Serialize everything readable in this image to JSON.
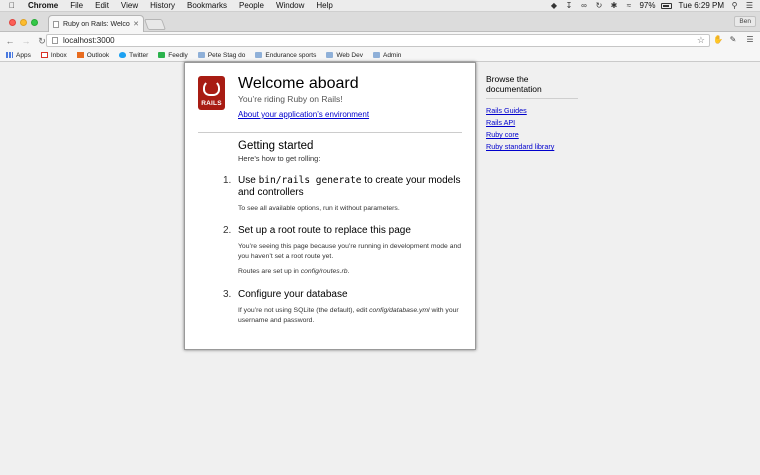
{
  "menubar": {
    "app_name": "Chrome",
    "menus": [
      "File",
      "Edit",
      "View",
      "History",
      "Bookmarks",
      "People",
      "Window",
      "Help"
    ],
    "battery": "97%",
    "clock": "Tue 6:29 PM"
  },
  "tab": {
    "title": "Ruby on Rails: Welcome aboard"
  },
  "profile_label": "Ben",
  "address_bar": {
    "url": "localhost:3000"
  },
  "bookmarks": [
    {
      "label": "Apps",
      "icon": "apps-grid-icon"
    },
    {
      "label": "Inbox",
      "icon": "gmail-icon"
    },
    {
      "label": "Outlook",
      "icon": "outlook-icon"
    },
    {
      "label": "Twitter",
      "icon": "twitter-icon"
    },
    {
      "label": "Feedly",
      "icon": "feedly-icon"
    },
    {
      "label": "Pete Stag do",
      "icon": "folder-icon"
    },
    {
      "label": "Endurance sports",
      "icon": "folder-icon"
    },
    {
      "label": "Web Dev",
      "icon": "folder-icon"
    },
    {
      "label": "Admin",
      "icon": "folder-icon"
    }
  ],
  "page": {
    "logo_text": "RAILS",
    "header_title": "Welcome aboard",
    "header_subtitle": "You’re riding Ruby on Rails!",
    "env_link": "About your application’s environment",
    "getting_started_title": "Getting started",
    "getting_started_subtitle": "Here’s how to get rolling:",
    "steps": [
      {
        "number": "1.",
        "title_pre": "Use ",
        "title_code": "bin/rails generate",
        "title_post": " to create your models and controllers",
        "body": [
          "To see all available options, run it without parameters."
        ]
      },
      {
        "number": "2.",
        "title": "Set up a root route to replace this page",
        "body": [
          "You’re seeing this page because you’re running in development mode and you haven’t set a root route yet.",
          "Routes are set up in config/routes.rb."
        ]
      },
      {
        "number": "3.",
        "title": "Configure your database",
        "body": [
          "If you’re not using SQLite (the default), edit config/database.yml with your username and password."
        ]
      }
    ],
    "sidebar": {
      "title": "Browse the documentation",
      "links": [
        "Rails Guides",
        "Rails API",
        "Ruby core",
        "Ruby standard library"
      ]
    }
  },
  "colors": {
    "link": "#0000cc",
    "rails_red": "#a81c13",
    "page_bg": "#f0f0f0"
  }
}
